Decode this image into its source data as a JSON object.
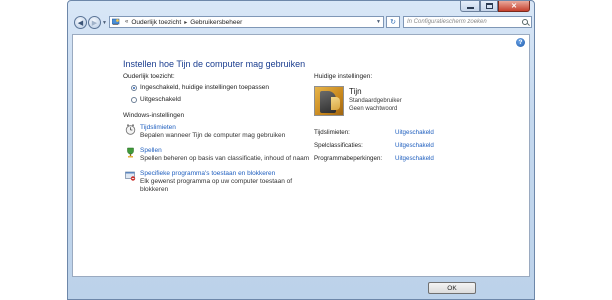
{
  "breadcrumb": {
    "prefix": "«",
    "items": [
      "Ouderlijk toezicht",
      "Gebruikersbeheer"
    ],
    "separator": "▸"
  },
  "search": {
    "placeholder": "In Configuratiescherm zoeken"
  },
  "page": {
    "title": "Instellen hoe Tijn de computer mag gebruiken"
  },
  "parental_control": {
    "label": "Ouderlijk toezicht:",
    "options": [
      {
        "label": "Ingeschakeld, huidige instellingen toepassen",
        "selected": true
      },
      {
        "label": "Uitgeschakeld",
        "selected": false
      }
    ]
  },
  "windows_settings": {
    "label": "Windows-instellingen",
    "items": [
      {
        "icon": "clock-icon",
        "link": "Tijdslimieten",
        "desc": [
          "Bepalen wanneer Tijn de computer mag gebruiken"
        ]
      },
      {
        "icon": "trophy-icon",
        "link": "Spellen",
        "desc": [
          "Spellen beheren op basis van classificatie, inhoud of naam"
        ]
      },
      {
        "icon": "program-icon",
        "link": "Specifieke programma's toestaan en blokkeren",
        "desc": [
          "Elk gewenst programma op uw computer toestaan of",
          "blokkeren"
        ]
      }
    ]
  },
  "current_settings": {
    "label": "Huidige instellingen:",
    "user": {
      "name": "Tijn",
      "role": "Standaardgebruiker",
      "password": "Geen wachtwoord"
    },
    "rows": [
      {
        "key": "Tijdslimieten:",
        "value": "Uitgeschakeld"
      },
      {
        "key": "Spelclassificaties:",
        "value": "Uitgeschakeld"
      },
      {
        "key": "Programmabeperkingen:",
        "value": "Uitgeschakeld"
      }
    ]
  },
  "footer": {
    "ok_label": "OK"
  },
  "colors": {
    "link": "#1f5fbf",
    "title": "#1a3d8f",
    "chrome": "#c4d8ee"
  }
}
